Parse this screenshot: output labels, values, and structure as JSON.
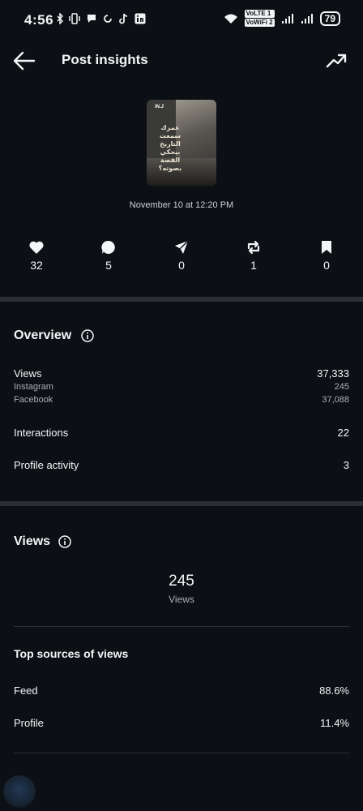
{
  "status": {
    "time": "4:56",
    "volte1": "VoLTE 1",
    "volte2": "VoWiFi 2",
    "battery": "79"
  },
  "header": {
    "title": "Post insights"
  },
  "post": {
    "thumbnail_text": "عمرك سمعت التاريخ بيحكي القصة بصوته؟",
    "thumbnail_tag": "iN.J",
    "date": "November 10 at 12:20 PM"
  },
  "stats": [
    {
      "icon": "heart-icon",
      "value": "32"
    },
    {
      "icon": "comment-icon",
      "value": "5"
    },
    {
      "icon": "share-icon",
      "value": "0"
    },
    {
      "icon": "repost-icon",
      "value": "1"
    },
    {
      "icon": "bookmark-icon",
      "value": "0"
    }
  ],
  "overview": {
    "title": "Overview",
    "views_label": "Views",
    "views_value": "37,333",
    "instagram_label": "Instagram",
    "instagram_value": "245",
    "facebook_label": "Facebook",
    "facebook_value": "37,088",
    "interactions_label": "Interactions",
    "interactions_value": "22",
    "profile_activity_label": "Profile activity",
    "profile_activity_value": "3"
  },
  "views_section": {
    "title": "Views",
    "total": "245",
    "total_label": "Views",
    "top_sources_title": "Top sources of views",
    "sources": [
      {
        "label": "Feed",
        "value": "88.6%"
      },
      {
        "label": "Profile",
        "value": "11.4%"
      }
    ]
  }
}
